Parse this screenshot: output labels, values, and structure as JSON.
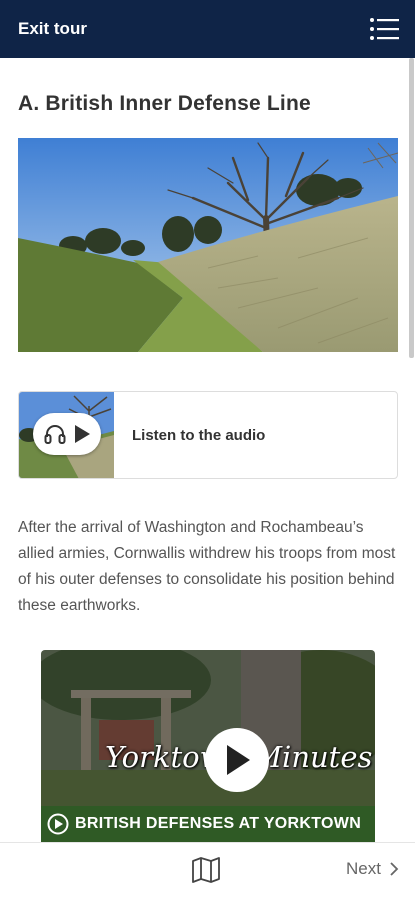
{
  "header": {
    "exit_label": "Exit tour",
    "menu_icon": "menu-list-icon",
    "background": "#0f2447"
  },
  "stop": {
    "title": "A. British Inner Defense Line",
    "audio_label": "Listen to the audio",
    "description": "After the arrival of Washington and Rochambeau’s allied armies, Cornwallis withdrew his troops from most of his outer defenses to consolidate his position behind these earthworks."
  },
  "video": {
    "script_title": "Yorktown Minutes",
    "banner": "BRITISH DEFENSES AT YORKTOWN",
    "banner_color": "#2f5a25"
  },
  "footer": {
    "map_icon": "map-icon",
    "next_label": "Next"
  }
}
